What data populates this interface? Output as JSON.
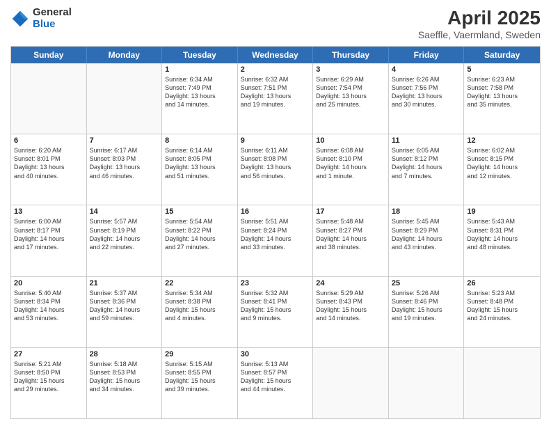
{
  "logo": {
    "general": "General",
    "blue": "Blue"
  },
  "title": {
    "month": "April 2025",
    "location": "Saeffle, Vaermland, Sweden"
  },
  "header_days": [
    "Sunday",
    "Monday",
    "Tuesday",
    "Wednesday",
    "Thursday",
    "Friday",
    "Saturday"
  ],
  "weeks": [
    [
      {
        "day": "",
        "text": ""
      },
      {
        "day": "",
        "text": ""
      },
      {
        "day": "1",
        "text": "Sunrise: 6:34 AM\nSunset: 7:49 PM\nDaylight: 13 hours\nand 14 minutes."
      },
      {
        "day": "2",
        "text": "Sunrise: 6:32 AM\nSunset: 7:51 PM\nDaylight: 13 hours\nand 19 minutes."
      },
      {
        "day": "3",
        "text": "Sunrise: 6:29 AM\nSunset: 7:54 PM\nDaylight: 13 hours\nand 25 minutes."
      },
      {
        "day": "4",
        "text": "Sunrise: 6:26 AM\nSunset: 7:56 PM\nDaylight: 13 hours\nand 30 minutes."
      },
      {
        "day": "5",
        "text": "Sunrise: 6:23 AM\nSunset: 7:58 PM\nDaylight: 13 hours\nand 35 minutes."
      }
    ],
    [
      {
        "day": "6",
        "text": "Sunrise: 6:20 AM\nSunset: 8:01 PM\nDaylight: 13 hours\nand 40 minutes."
      },
      {
        "day": "7",
        "text": "Sunrise: 6:17 AM\nSunset: 8:03 PM\nDaylight: 13 hours\nand 46 minutes."
      },
      {
        "day": "8",
        "text": "Sunrise: 6:14 AM\nSunset: 8:05 PM\nDaylight: 13 hours\nand 51 minutes."
      },
      {
        "day": "9",
        "text": "Sunrise: 6:11 AM\nSunset: 8:08 PM\nDaylight: 13 hours\nand 56 minutes."
      },
      {
        "day": "10",
        "text": "Sunrise: 6:08 AM\nSunset: 8:10 PM\nDaylight: 14 hours\nand 1 minute."
      },
      {
        "day": "11",
        "text": "Sunrise: 6:05 AM\nSunset: 8:12 PM\nDaylight: 14 hours\nand 7 minutes."
      },
      {
        "day": "12",
        "text": "Sunrise: 6:02 AM\nSunset: 8:15 PM\nDaylight: 14 hours\nand 12 minutes."
      }
    ],
    [
      {
        "day": "13",
        "text": "Sunrise: 6:00 AM\nSunset: 8:17 PM\nDaylight: 14 hours\nand 17 minutes."
      },
      {
        "day": "14",
        "text": "Sunrise: 5:57 AM\nSunset: 8:19 PM\nDaylight: 14 hours\nand 22 minutes."
      },
      {
        "day": "15",
        "text": "Sunrise: 5:54 AM\nSunset: 8:22 PM\nDaylight: 14 hours\nand 27 minutes."
      },
      {
        "day": "16",
        "text": "Sunrise: 5:51 AM\nSunset: 8:24 PM\nDaylight: 14 hours\nand 33 minutes."
      },
      {
        "day": "17",
        "text": "Sunrise: 5:48 AM\nSunset: 8:27 PM\nDaylight: 14 hours\nand 38 minutes."
      },
      {
        "day": "18",
        "text": "Sunrise: 5:45 AM\nSunset: 8:29 PM\nDaylight: 14 hours\nand 43 minutes."
      },
      {
        "day": "19",
        "text": "Sunrise: 5:43 AM\nSunset: 8:31 PM\nDaylight: 14 hours\nand 48 minutes."
      }
    ],
    [
      {
        "day": "20",
        "text": "Sunrise: 5:40 AM\nSunset: 8:34 PM\nDaylight: 14 hours\nand 53 minutes."
      },
      {
        "day": "21",
        "text": "Sunrise: 5:37 AM\nSunset: 8:36 PM\nDaylight: 14 hours\nand 59 minutes."
      },
      {
        "day": "22",
        "text": "Sunrise: 5:34 AM\nSunset: 8:38 PM\nDaylight: 15 hours\nand 4 minutes."
      },
      {
        "day": "23",
        "text": "Sunrise: 5:32 AM\nSunset: 8:41 PM\nDaylight: 15 hours\nand 9 minutes."
      },
      {
        "day": "24",
        "text": "Sunrise: 5:29 AM\nSunset: 8:43 PM\nDaylight: 15 hours\nand 14 minutes."
      },
      {
        "day": "25",
        "text": "Sunrise: 5:26 AM\nSunset: 8:46 PM\nDaylight: 15 hours\nand 19 minutes."
      },
      {
        "day": "26",
        "text": "Sunrise: 5:23 AM\nSunset: 8:48 PM\nDaylight: 15 hours\nand 24 minutes."
      }
    ],
    [
      {
        "day": "27",
        "text": "Sunrise: 5:21 AM\nSunset: 8:50 PM\nDaylight: 15 hours\nand 29 minutes."
      },
      {
        "day": "28",
        "text": "Sunrise: 5:18 AM\nSunset: 8:53 PM\nDaylight: 15 hours\nand 34 minutes."
      },
      {
        "day": "29",
        "text": "Sunrise: 5:15 AM\nSunset: 8:55 PM\nDaylight: 15 hours\nand 39 minutes."
      },
      {
        "day": "30",
        "text": "Sunrise: 5:13 AM\nSunset: 8:57 PM\nDaylight: 15 hours\nand 44 minutes."
      },
      {
        "day": "",
        "text": ""
      },
      {
        "day": "",
        "text": ""
      },
      {
        "day": "",
        "text": ""
      }
    ]
  ]
}
